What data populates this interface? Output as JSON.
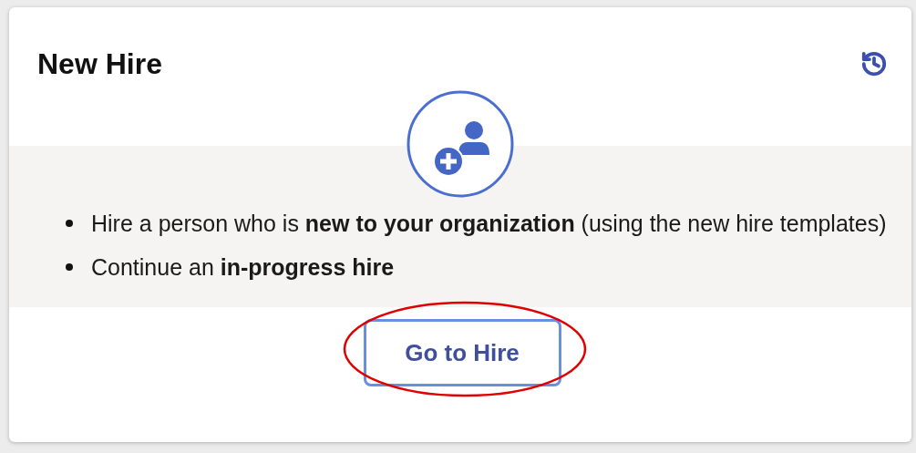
{
  "card": {
    "title": "New Hire",
    "bullets": [
      "Hire a person who is **new to your organization** (using the new hire templates)",
      "Continue an **in-progress hire**"
    ],
    "button": {
      "label": "Go to Hire"
    }
  },
  "annotation": {
    "kind": "ellipse",
    "color": "#e00000"
  }
}
